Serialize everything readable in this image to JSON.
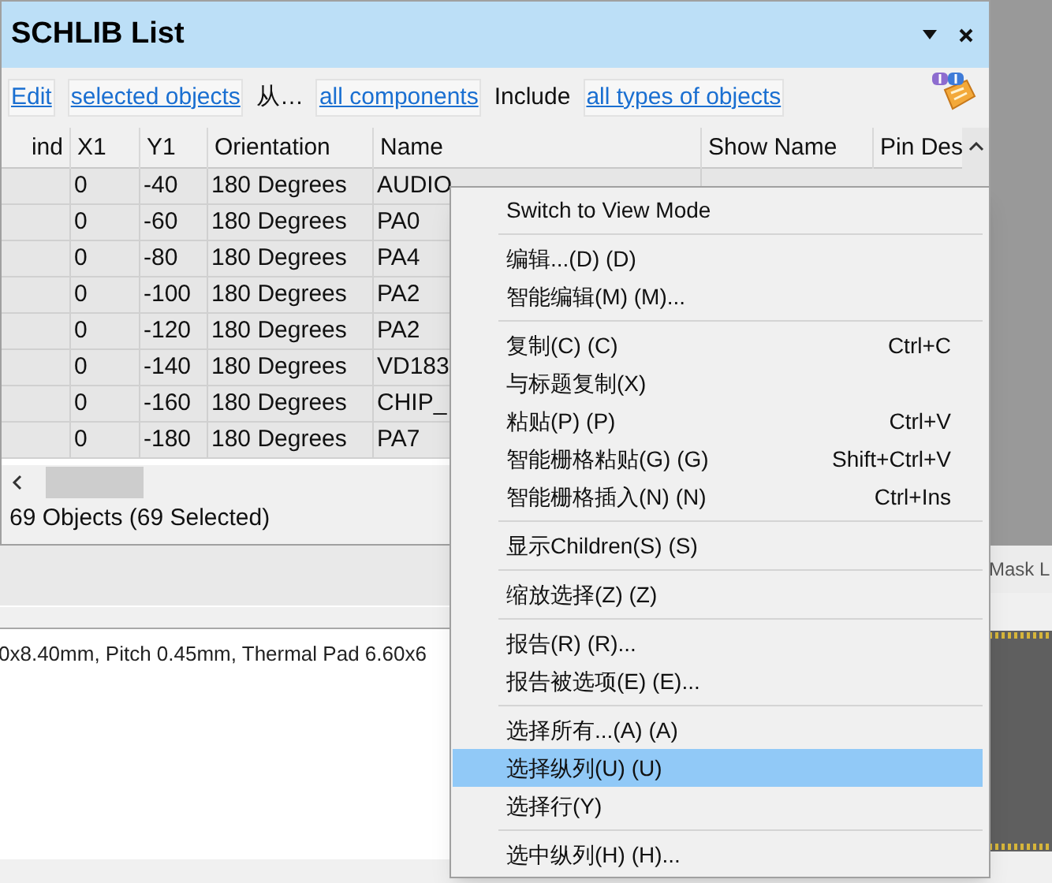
{
  "panel": {
    "title": "SCHLIB List",
    "toolbar": [
      {
        "kind": "link",
        "text": "Edit"
      },
      {
        "kind": "link",
        "text": "selected objects"
      },
      {
        "kind": "text",
        "text": "从…"
      },
      {
        "kind": "link",
        "text": "all components"
      },
      {
        "kind": "text",
        "text": "Include"
      },
      {
        "kind": "link",
        "text": "all types of objects"
      }
    ],
    "table": {
      "columns": [
        "ind",
        "X1",
        "Y1",
        "Orientation",
        "Name",
        "Show Name",
        "Pin Des"
      ],
      "rows": [
        {
          "selected": true,
          "cells": [
            "",
            "0",
            "-40",
            "180 Degrees",
            "AUDIO"
          ]
        },
        {
          "selected": true,
          "cells": [
            "",
            "0",
            "-60",
            "180 Degrees",
            "PA0"
          ]
        },
        {
          "selected": true,
          "cells": [
            "",
            "0",
            "-80",
            "180 Degrees",
            "PA4"
          ]
        },
        {
          "selected": true,
          "cells": [
            "",
            "0",
            "-100",
            "180 Degrees",
            "PA2"
          ]
        },
        {
          "selected": true,
          "cells": [
            "",
            "0",
            "-120",
            "180 Degrees",
            "PA2"
          ]
        },
        {
          "selected": true,
          "cells": [
            "",
            "0",
            "-140",
            "180 Degrees",
            "VD183"
          ]
        },
        {
          "selected": true,
          "cells": [
            "",
            "0",
            "-160",
            "180 Degrees",
            "CHIP_"
          ]
        },
        {
          "selected": true,
          "cells": [
            "",
            "0",
            "-180",
            "180 Degrees",
            "PA7"
          ]
        }
      ]
    },
    "status_bar": "69 Objects (69 Selected)"
  },
  "description": "0x8.40mm, Pitch 0.45mm, Thermal Pad 6.60x6",
  "tab": "Mask L",
  "context_menu": {
    "items": [
      {
        "kind": "item",
        "label": "Switch to View Mode",
        "selected": false
      },
      {
        "kind": "separator"
      },
      {
        "kind": "item",
        "label": "编辑...(D) (D)",
        "selected": false
      },
      {
        "kind": "item",
        "label": "智能编辑(M) (M)...",
        "selected": false
      },
      {
        "kind": "separator"
      },
      {
        "kind": "item",
        "label": "复制(C) (C)",
        "shortcut": "Ctrl+C",
        "selected": false
      },
      {
        "kind": "item",
        "label": "与标题复制(X)",
        "selected": false
      },
      {
        "kind": "item",
        "label": "粘贴(P) (P)",
        "shortcut": "Ctrl+V",
        "selected": false
      },
      {
        "kind": "item",
        "label": "智能栅格粘贴(G) (G)",
        "shortcut": "Shift+Ctrl+V",
        "selected": false
      },
      {
        "kind": "item",
        "label": "智能栅格插入(N) (N)",
        "shortcut": "Ctrl+Ins",
        "selected": false
      },
      {
        "kind": "separator"
      },
      {
        "kind": "item",
        "label": "显示Children(S) (S)",
        "selected": false
      },
      {
        "kind": "separator"
      },
      {
        "kind": "item",
        "label": "缩放选择(Z) (Z)",
        "selected": false
      },
      {
        "kind": "separator"
      },
      {
        "kind": "item",
        "label": "报告(R) (R)...",
        "selected": false
      },
      {
        "kind": "item",
        "label": "报告被选项(E) (E)...",
        "selected": false
      },
      {
        "kind": "separator"
      },
      {
        "kind": "item",
        "label": "选择所有...(A) (A)",
        "selected": false
      },
      {
        "kind": "item",
        "label": "选择纵列(U) (U)",
        "selected": true
      },
      {
        "kind": "item",
        "label": "选择行(Y)",
        "selected": false
      },
      {
        "kind": "separator"
      },
      {
        "kind": "item",
        "label": "选中纵列(H) (H)...",
        "selected": false
      }
    ]
  }
}
